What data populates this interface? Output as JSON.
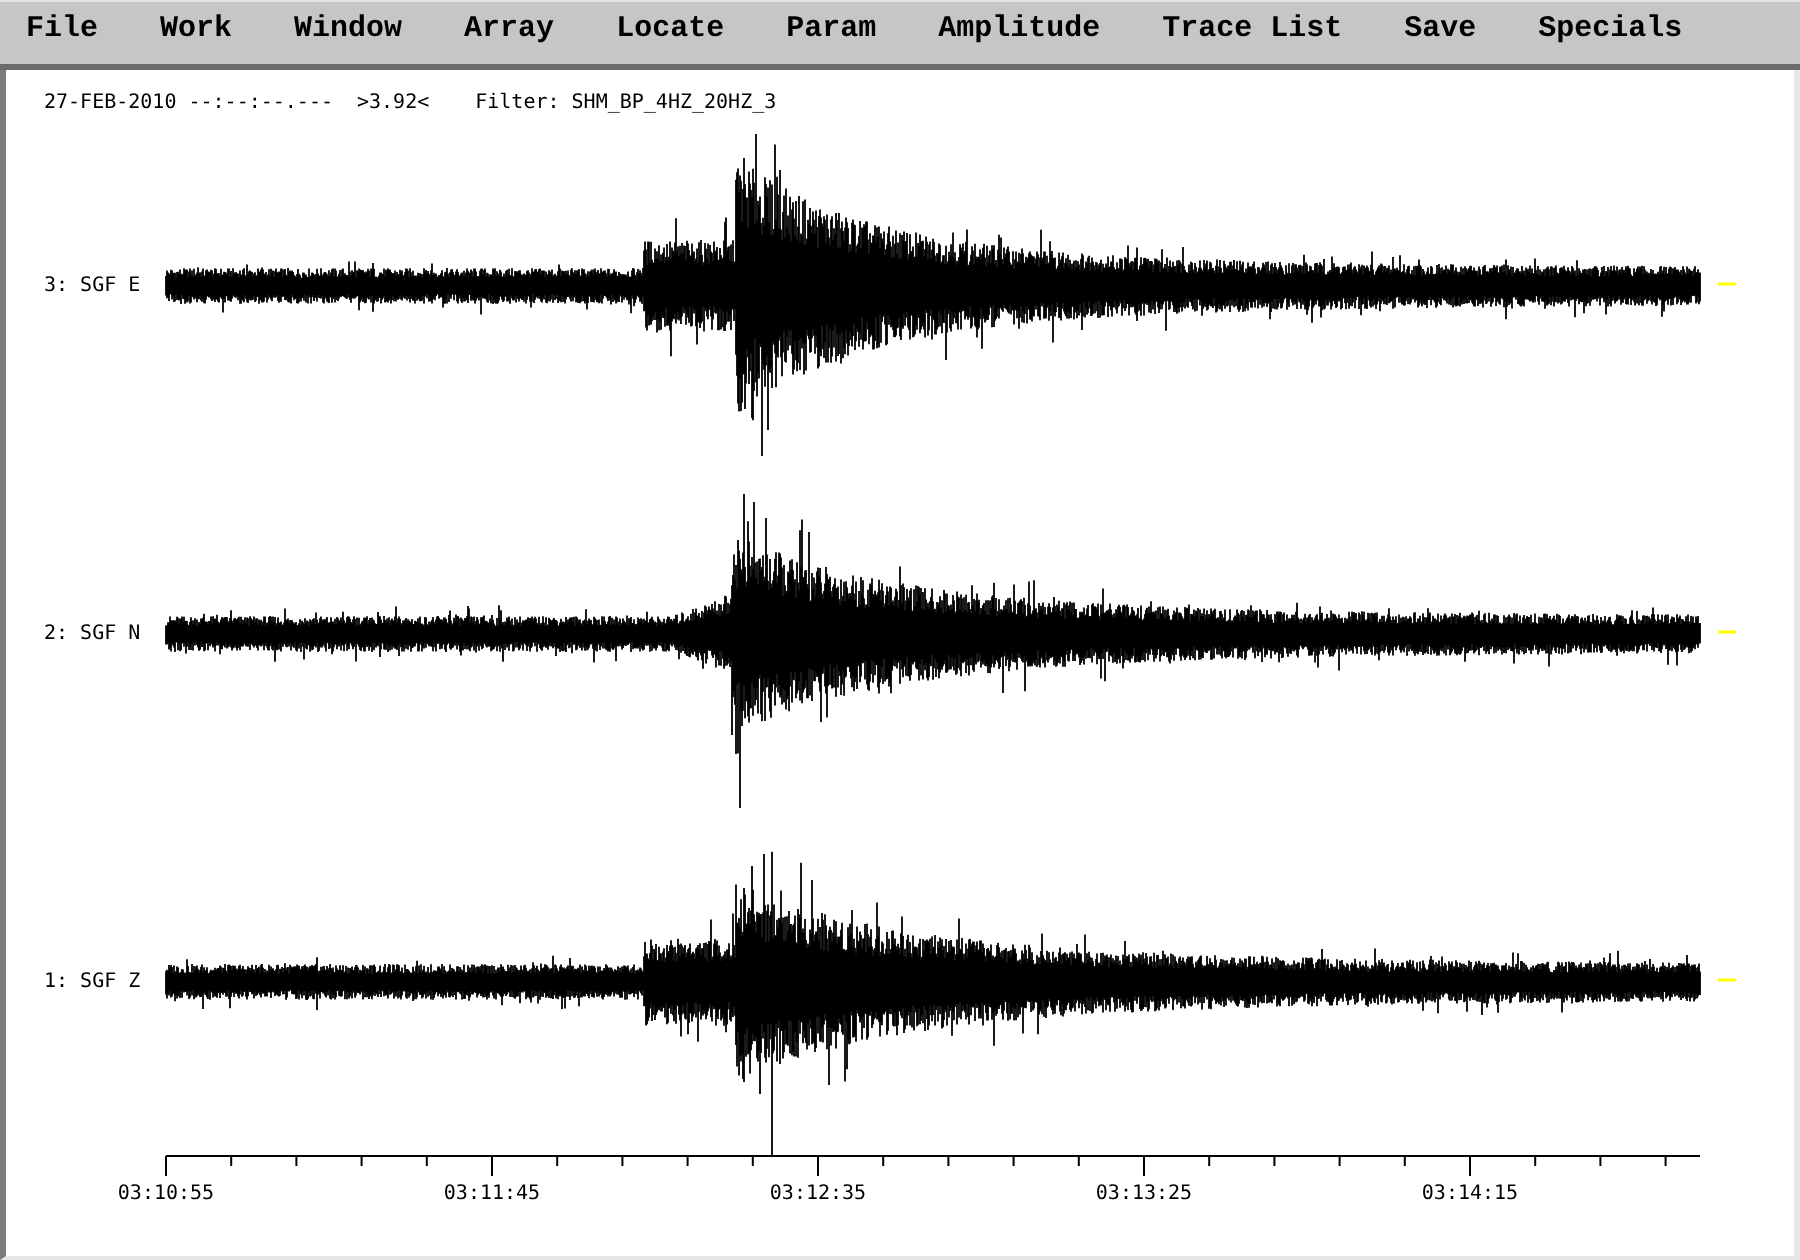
{
  "menu": [
    {
      "label": "File"
    },
    {
      "label": "Work"
    },
    {
      "label": "Window"
    },
    {
      "label": "Array"
    },
    {
      "label": "Locate"
    },
    {
      "label": "Param"
    },
    {
      "label": "Amplitude"
    },
    {
      "label": "Trace List"
    },
    {
      "label": "Save"
    },
    {
      "label": "Specials"
    }
  ],
  "header": {
    "date_time": "27-FEB-2010 --:--:--.---",
    "reading": ">3.92<",
    "filter": "Filter: SHM_BP_4HZ_20HZ_3"
  },
  "traces": [
    {
      "label": "3: SGF E"
    },
    {
      "label": "2: SGF N"
    },
    {
      "label": "1: SGF Z"
    }
  ],
  "time_axis": {
    "tick_labels": [
      "03:10:55",
      "03:11:45",
      "03:12:35",
      "03:13:25",
      "03:14:15"
    ]
  }
}
